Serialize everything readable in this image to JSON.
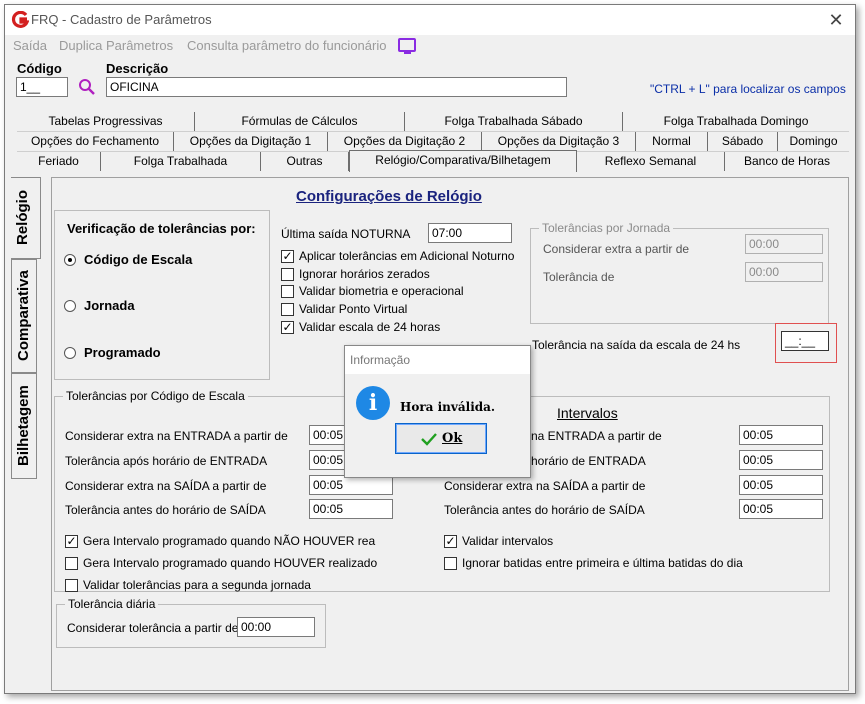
{
  "window": {
    "title": "FRQ - Cadastro de Parâmetros",
    "close_glyph": "✕"
  },
  "menu": {
    "items": [
      "Saída",
      "Duplica Parâmetros",
      "Consulta parâmetro do funcionário"
    ],
    "icon": "monitor-icon"
  },
  "header": {
    "codigo_label": "Código",
    "codigo_value": "1__",
    "descricao_label": "Descrição",
    "descricao_value": "OFICINA",
    "search_icon": "search-icon",
    "hint": "\"CTRL + L\" para localizar os campos"
  },
  "tabs": {
    "row1": [
      "Tabelas Progressivas",
      "Fórmulas de Cálculos",
      "Folga Trabalhada Sábado",
      "Folga Trabalhada Domingo"
    ],
    "row2": [
      "Opções do Fechamento",
      "Opções da Digitação 1",
      "Opções da Digitação 2",
      "Opções da Digitação 3",
      "Normal",
      "Sábado",
      "Domingo"
    ],
    "row3": [
      "Feriado",
      "Folga Trabalhada",
      "Outras",
      "Relógio/Comparativa/Bilhetagem",
      "Reflexo Semanal",
      "Banco de Horas"
    ],
    "active": "Relógio/Comparativa/Bilhetagem"
  },
  "vertical_tabs": [
    "Relógio",
    "Comparativa",
    "Bilhetagem"
  ],
  "section_title": "Configurações de Relógio",
  "verificacao": {
    "title": "Verificação de tolerâncias por:",
    "options": [
      "Código de Escala",
      "Jornada",
      "Programado"
    ],
    "selected": "Código de Escala"
  },
  "noturna": {
    "label": "Última saída NOTURNA",
    "value": "07:00"
  },
  "checkboxes_top": [
    {
      "label": "Aplicar tolerâncias em Adicional Noturno",
      "checked": true
    },
    {
      "label": "Ignorar horários zerados",
      "checked": false
    },
    {
      "label": "Validar biometria e operacional",
      "checked": false
    },
    {
      "label": "Validar Ponto Virtual",
      "checked": false
    },
    {
      "label": "Validar escala de 24 horas",
      "checked": true
    }
  ],
  "tolerancias_jornada": {
    "title": "Tolerâncias por Jornada",
    "extra_label": "Considerar extra a partir de",
    "extra_value": "00:00",
    "tolerancia_label": "Tolerância de",
    "tolerancia_value": "00:00"
  },
  "saida_24": {
    "label": "Tolerância na saída da escala de 24 hs",
    "value": "__:__"
  },
  "codigo_escala": {
    "title": "Tolerâncias por Código de Escala",
    "rows": [
      {
        "label": "Considerar extra na ENTRADA a partir de",
        "value": "00:05"
      },
      {
        "label": "Tolerância após horário de ENTRADA",
        "value": "00:05"
      },
      {
        "label": "Considerar extra na SAÍDA a partir de",
        "value": "00:05"
      },
      {
        "label": "Tolerância antes do horário de SAÍDA",
        "value": "00:05"
      }
    ]
  },
  "intervalos": {
    "title": "Intervalos",
    "rows": [
      {
        "label": "na ENTRADA a partir de",
        "value": "00:05"
      },
      {
        "label": "horário de ENTRADA",
        "value": "00:05"
      },
      {
        "label": "Considerar extra na SAÍDA a partir de",
        "value": "00:05"
      },
      {
        "label": "Tolerância antes do horário de SAÍDA",
        "value": "00:05"
      }
    ]
  },
  "checkboxes_bottom_left": [
    {
      "label": "Gera Intervalo programado quando NÃO HOUVER rea",
      "checked": true
    },
    {
      "label": "Gera Intervalo programado quando HOUVER realizado",
      "checked": false
    },
    {
      "label": "Validar tolerâncias para a segunda jornada",
      "checked": false
    }
  ],
  "checkboxes_bottom_right": [
    {
      "label": "Validar intervalos",
      "checked": true
    },
    {
      "label": "Ignorar batidas entre primeira e última batidas do dia",
      "checked": false
    }
  ],
  "tolerancia_diaria": {
    "title": "Tolerância diária",
    "label": "Considerar tolerância a partir de",
    "value": "00:00"
  },
  "dialog": {
    "title": "Informação",
    "message": "Hora inválida.",
    "ok_label": "Ok",
    "icon": "info-icon",
    "check_icon": "check-icon"
  },
  "colors": {
    "accent_title": "#1a237e",
    "hint_blue": "#0b2fa8",
    "info_blue": "#1e88e5",
    "highlight_red": "#e05050"
  }
}
